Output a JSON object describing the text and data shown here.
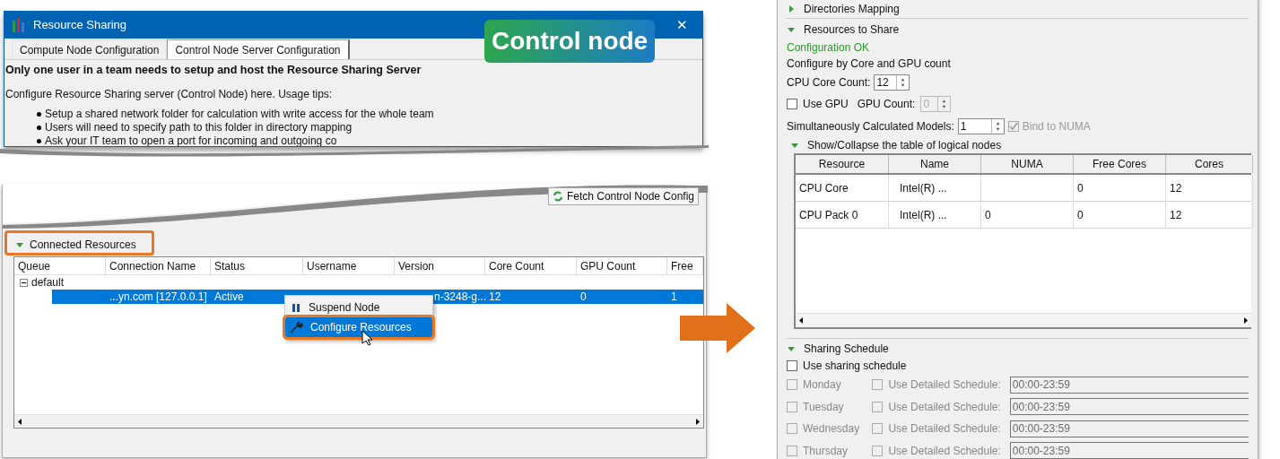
{
  "top_window": {
    "title": "Resource Sharing",
    "close": "✕",
    "badge": "Control node",
    "tabs": [
      {
        "label": "Compute Node Configuration",
        "selected": false
      },
      {
        "label": "Control Node Server Configuration",
        "selected": true
      }
    ],
    "heading": "Only one user in a team needs to setup and host the Resource Sharing Server",
    "intro": "Configure Resource Sharing server (Control Node) here. Usage tips:",
    "tips": [
      "Setup a shared network folder for calculation with write access for the whole team",
      "Users will need to specify path to this folder in directory mapping",
      "Ask your IT team to open a port for incoming and outgoing co"
    ]
  },
  "resources_panel": {
    "fetch_button": "Fetch Control Node Config",
    "section": {
      "label": "Connected Resources",
      "expanded": true
    },
    "columns": [
      "Queue",
      "Connection Name",
      "Status",
      "Username",
      "Version",
      "Core Count",
      "GPU Count",
      "Free"
    ],
    "tree": [
      {
        "label": "default",
        "expanded": true,
        "children": [
          {
            "selected": true,
            "cells": [
              "",
              "...yn.com [127.0.0.1]",
              "Active",
              "",
              "n-3248-g...",
              "12",
              "0",
              "1"
            ]
          }
        ]
      }
    ],
    "context_menu": [
      {
        "label": "Suspend Node",
        "kind": "pause",
        "selected": false
      },
      {
        "label": "Configure Resources",
        "kind": "wrench",
        "selected": true
      }
    ]
  },
  "config_panel": {
    "sections": [
      {
        "label": "Directories Mapping",
        "expanded": false
      },
      {
        "label": "Resources to Share",
        "expanded": true
      }
    ],
    "status": "Configuration OK",
    "mode": "Configure by Core and GPU count",
    "cpu_core_count": {
      "label": "CPU Core Count:",
      "value": "12"
    },
    "use_gpu": {
      "label": "Use GPU",
      "checked": false
    },
    "gpu_count": {
      "label": "GPU Count:",
      "value": "0",
      "disabled": true
    },
    "models": {
      "label": "Simultaneously Calculated Models:",
      "value": "1"
    },
    "bind_numa": {
      "label": "Bind to NUMA",
      "checked": true,
      "disabled": true
    },
    "table_toggle": {
      "label": "Show/Collapse the table of logical nodes",
      "expanded": true
    },
    "table": {
      "columns": [
        "Resource",
        "Name",
        "NUMA",
        "Free Cores",
        "Cores"
      ],
      "rows": [
        [
          "CPU Core",
          "Intel(R) ...",
          "",
          "0",
          "12"
        ],
        [
          "CPU Pack 0",
          "Intel(R) ...",
          "0",
          "0",
          "12"
        ]
      ]
    },
    "schedule": {
      "label": "Sharing Schedule",
      "expanded": true,
      "use": {
        "label": "Use sharing schedule",
        "checked": false
      },
      "days": [
        {
          "day": "Monday",
          "checked": false,
          "detailed": false,
          "detail_label": "Use Detailed Schedule:",
          "value": "00:00-23:59"
        },
        {
          "day": "Tuesday",
          "checked": false,
          "detailed": false,
          "detail_label": "Use Detailed Schedule:",
          "value": "00:00-23:59"
        },
        {
          "day": "Wednesday",
          "checked": false,
          "detailed": false,
          "detail_label": "Use Detailed Schedule:",
          "value": "00:00-23:59"
        },
        {
          "day": "Thursday",
          "checked": false,
          "detailed": false,
          "detail_label": "Use Detailed Schedule:",
          "value": "00:00-23:59"
        }
      ]
    }
  }
}
